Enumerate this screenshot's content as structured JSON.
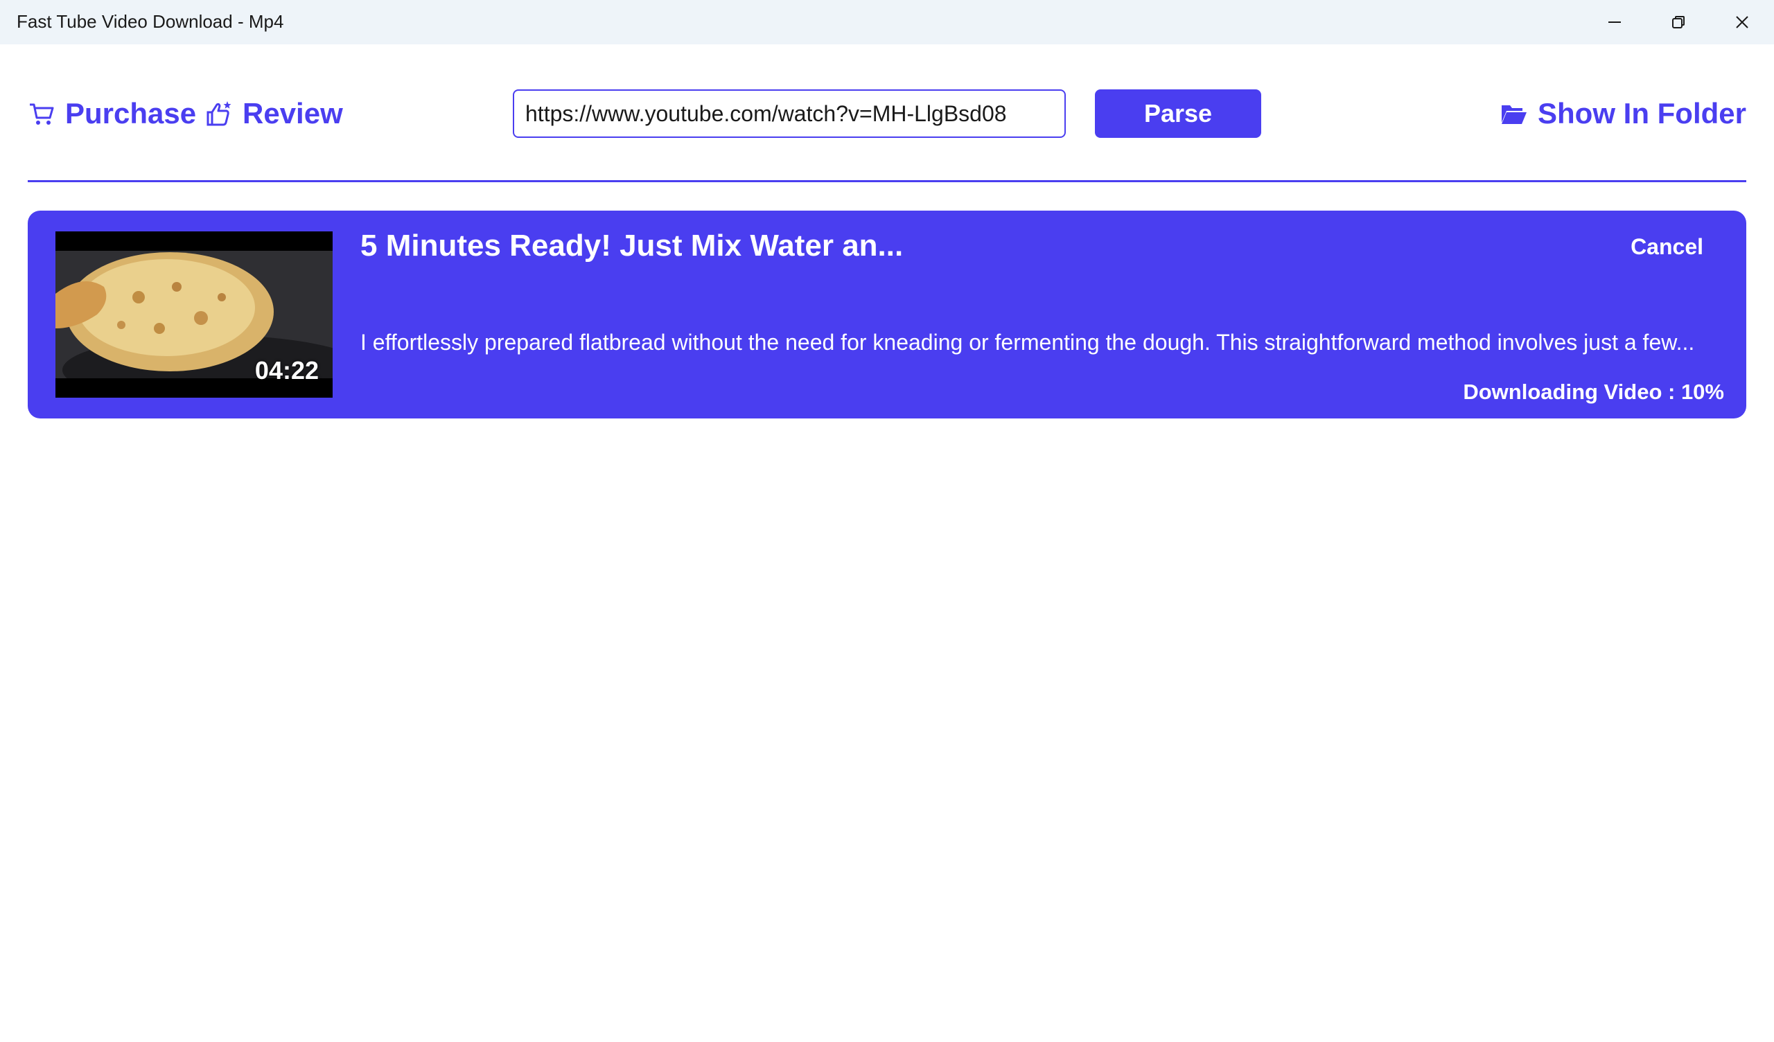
{
  "window": {
    "title": "Fast Tube Video Download - Mp4"
  },
  "toolbar": {
    "purchase_label": "Purchase",
    "review_label": "Review",
    "url_value": "https://www.youtube.com/watch?v=MH-LlgBsd08",
    "parse_label": "Parse",
    "show_in_folder_label": "Show In Folder"
  },
  "download": {
    "title": "5 Minutes Ready! Just Mix Water an...",
    "description": "I effortlessly prepared flatbread without the need for kneading or fermenting the dough. This straightforward method involves just a few...",
    "duration": "04:22",
    "cancel_label": "Cancel",
    "status": "Downloading Video : 10%",
    "progress_percent": 10
  },
  "colors": {
    "accent": "#4a3ef0",
    "titlebar_bg": "#eef4f9"
  },
  "icons": {
    "purchase": "cart-icon",
    "review": "thumbs-up-icon",
    "folder": "folder-open-icon",
    "minimize": "minimize-icon",
    "maximize": "restore-icon",
    "close": "close-icon"
  }
}
